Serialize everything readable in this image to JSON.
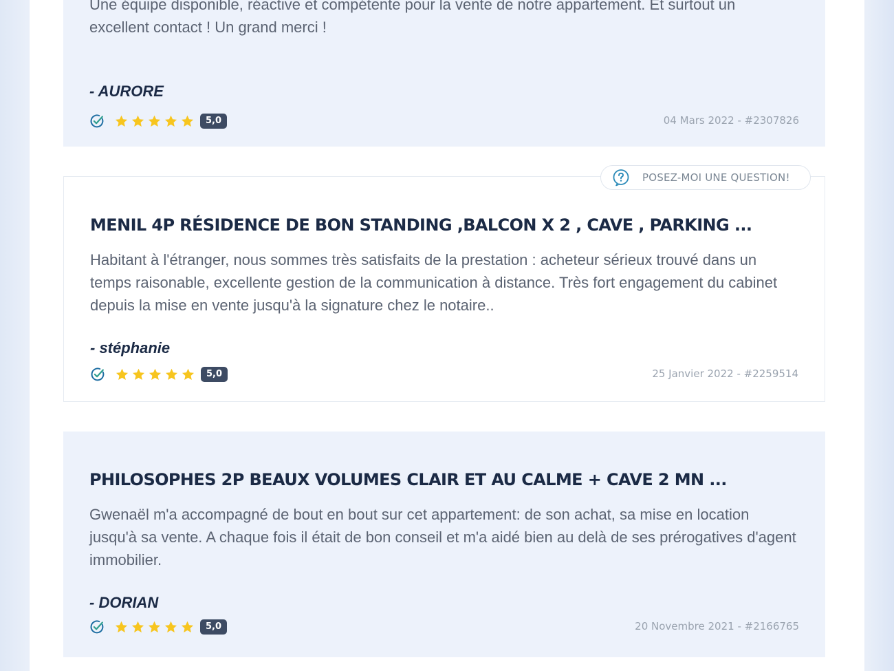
{
  "reviews": [
    {
      "title": "",
      "text": "Une équipe disponible, réactive et compétente pour la vente de notre appartement. Et surtout un excellent contact ! Un grand merci !",
      "author": "- AURORE",
      "score": "5,0",
      "stars": 5,
      "meta": "04 Mars 2022 - #2307826"
    },
    {
      "title": "MENIL 4P RÉSIDENCE DE BON STANDING ,BALCON X 2 , CAVE , PARKING ...",
      "text": "Habitant à l'étranger, nous sommes très satisfaits de la prestation : acheteur sérieux trouvé dans un temps raisonable, excellente gestion de la communication à distance. Très fort engagement du cabinet depuis la mise en vente jusqu'à la signature chez le notaire..",
      "author": "- stéphanie",
      "score": "5,0",
      "stars": 5,
      "meta": "25 Janvier 2022 - #2259514"
    },
    {
      "title": "PHILOSOPHES 2P BEAUX VOLUMES CLAIR ET AU CALME + CAVE 2 MN ...",
      "text": "Gwenaël m'a accompagné de bout en bout sur cet appartement: de son achat, sa mise en location jusqu'à sa vente. A chaque fois il était de bon conseil et m'a aidé bien au delà de ses prérogatives d'agent immobilier.",
      "author": "- DORIAN",
      "score": "5,0",
      "stars": 5,
      "meta": "20 Novembre 2021 - #2166765"
    }
  ],
  "ask_button": {
    "label": "POSEZ-MOI UNE QUESTION!",
    "icon": "question-circle-icon"
  },
  "icons": {
    "verified": "verified-check-icon",
    "star": "star-icon"
  },
  "colors": {
    "star": "#f7c51e",
    "verified": "#1f6fa3",
    "title": "#1b2a45",
    "card_shaded": "#edf2fb",
    "score_badge": "#3d4b63"
  }
}
